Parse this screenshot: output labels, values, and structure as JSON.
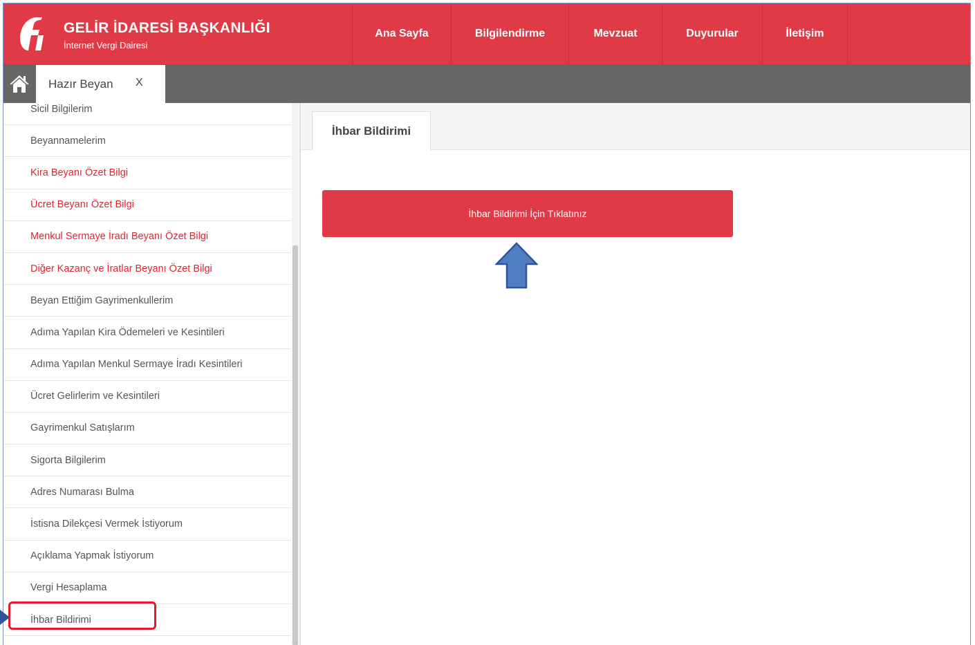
{
  "header": {
    "title": "GELİR İDARESİ BAŞKANLIĞI",
    "subtitle": "İnternet Vergi Dairesi",
    "logo_icon": "gib-logo-icon",
    "bg_color": "#e03a47",
    "nav": [
      {
        "label": "Ana Sayfa"
      },
      {
        "label": "Bilgilendirme"
      },
      {
        "label": "Mevzuat"
      },
      {
        "label": "Duyurular"
      },
      {
        "label": "İletişim"
      }
    ]
  },
  "tabbar": {
    "home_icon": "home-icon",
    "open_tab": {
      "label": "Hazır Beyan",
      "close": "X"
    }
  },
  "sidebar": {
    "items": [
      {
        "label": "Sicil Bilgilerim",
        "red": false
      },
      {
        "label": "Beyannamelerim",
        "red": false
      },
      {
        "label": "Kira Beyanı Özet Bilgi",
        "red": true
      },
      {
        "label": "Ücret Beyanı Özet Bilgi",
        "red": true
      },
      {
        "label": "Menkul Sermaye İradı Beyanı Özet Bilgi",
        "red": true
      },
      {
        "label": "Diğer Kazanç ve İratlar Beyanı Özet Bilgi",
        "red": true
      },
      {
        "label": "Beyan Ettiğim Gayrimenkullerim",
        "red": false
      },
      {
        "label": "Adıma Yapılan Kira Ödemeleri ve Kesintileri",
        "red": false
      },
      {
        "label": "Adıma Yapılan Menkul Sermaye İradı Kesintileri",
        "red": false
      },
      {
        "label": "Ücret Gelirlerim ve Kesintileri",
        "red": false
      },
      {
        "label": "Gayrimenkul Satışlarım",
        "red": false
      },
      {
        "label": "Sigorta Bilgilerim",
        "red": false
      },
      {
        "label": "Adres Numarası Bulma",
        "red": false
      },
      {
        "label": "İstisna Dilekçesi Vermek İstiyorum",
        "red": false
      },
      {
        "label": "Açıklama Yapmak İstiyorum",
        "red": false
      },
      {
        "label": "Vergi Hesaplama",
        "red": false
      },
      {
        "label": "İhbar Bildirimi",
        "red": false
      }
    ]
  },
  "main": {
    "tab_label": "İhbar Bildirimi",
    "action_button": "İhbar Bildirimi İçin Tıklatınız"
  },
  "annotations": {
    "highlight_color": "#e51a2a",
    "arrow_color": "#2f5597"
  }
}
